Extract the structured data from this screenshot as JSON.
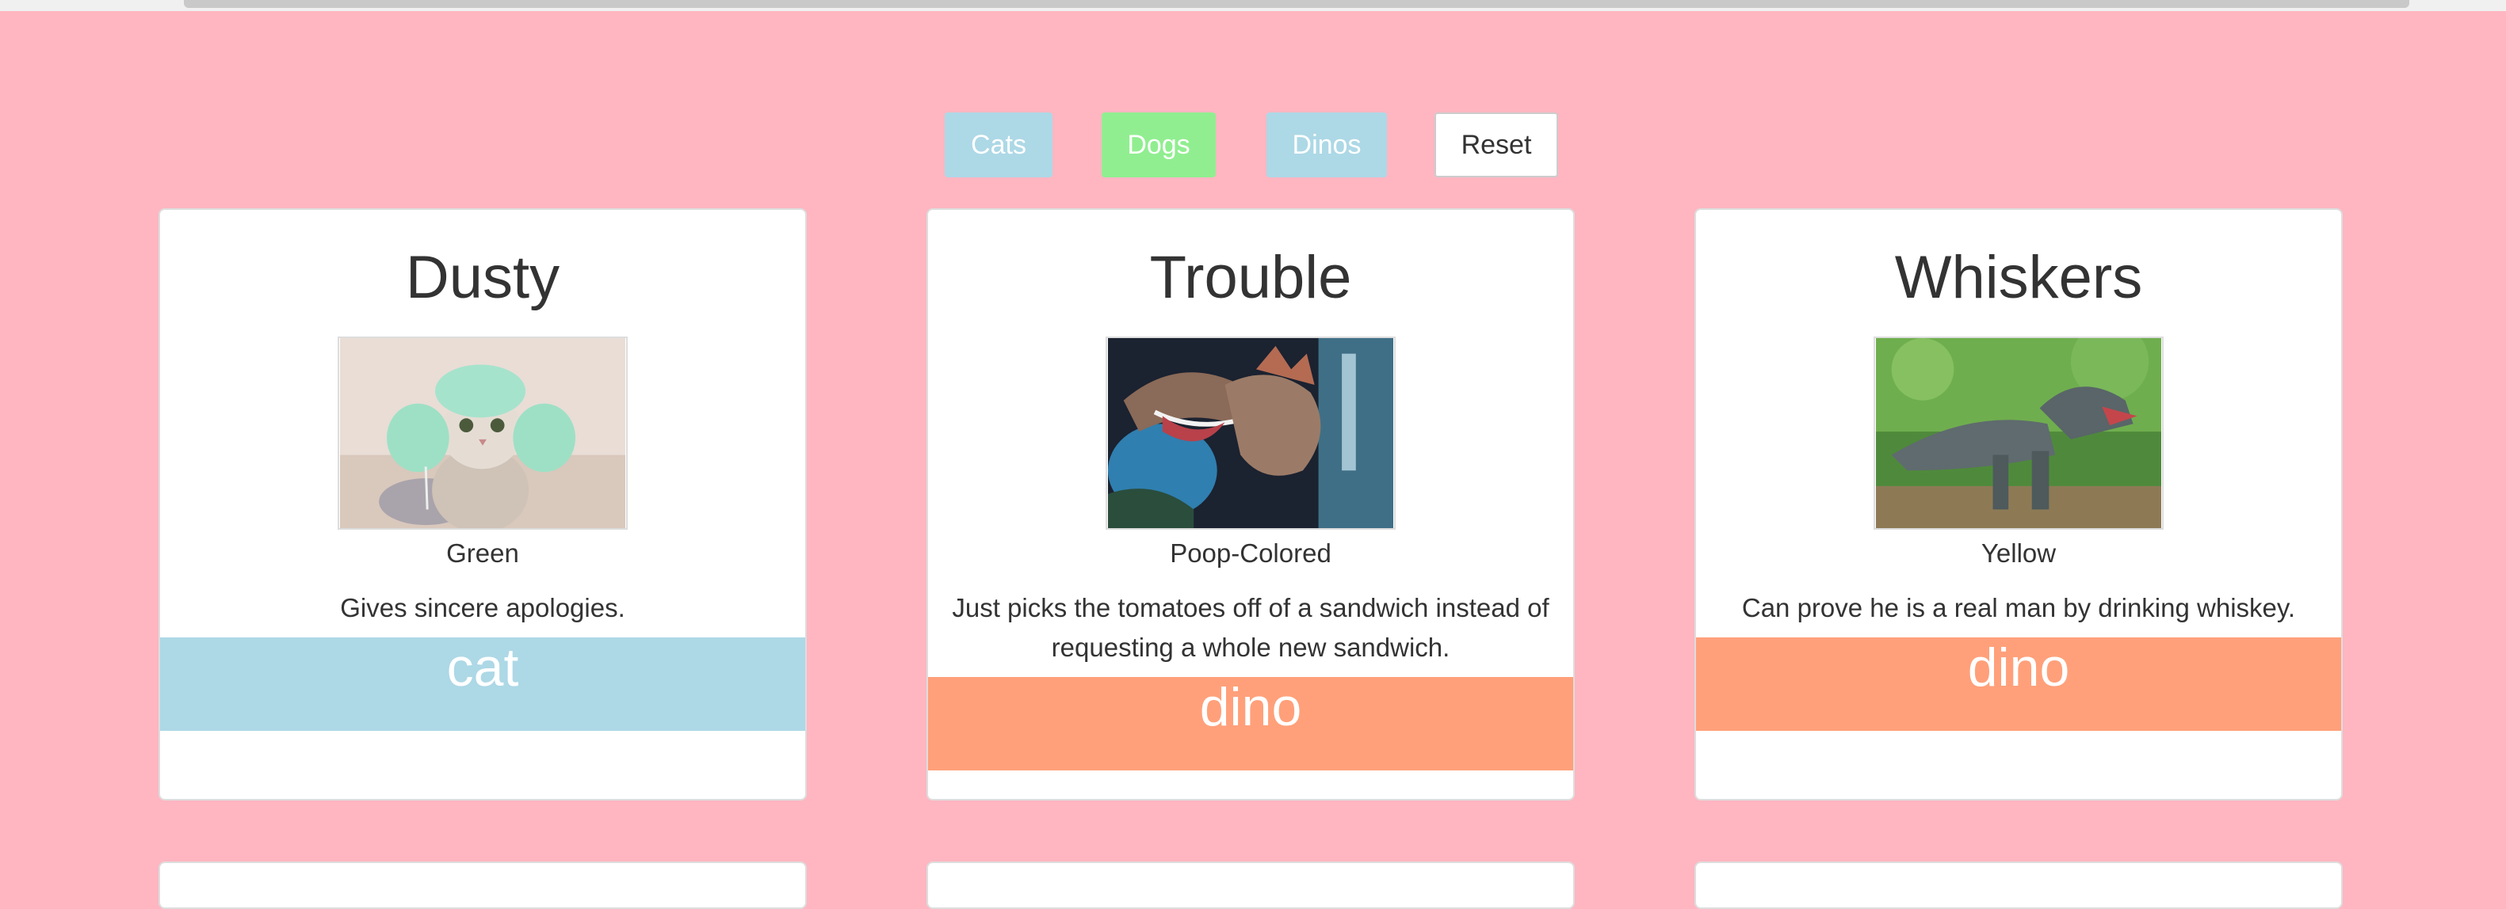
{
  "filters": {
    "cats_label": "Cats",
    "dogs_label": "Dogs",
    "dinos_label": "Dinos",
    "reset_label": "Reset"
  },
  "colors": {
    "page_background": "#ffb6c1",
    "filter_inactive": "#add8e6",
    "filter_active": "#90ee90",
    "type_cat": "#add8e6",
    "type_dino": "#ffa07a"
  },
  "cards": [
    {
      "name": "Dusty",
      "color": "Green",
      "description": "Gives sincere apologies.",
      "type": "cat",
      "photo_icon": "cat-photo"
    },
    {
      "name": "Trouble",
      "color": "Poop-Colored",
      "description": "Just picks the tomatoes off of a sandwich instead of requesting a whole new sandwich.",
      "type": "dino",
      "photo_icon": "dinosaur-photo"
    },
    {
      "name": "Whiskers",
      "color": "Yellow",
      "description": "Can prove he is a real man by drinking whiskey.",
      "type": "dino",
      "photo_icon": "dinosaur-photo"
    }
  ]
}
